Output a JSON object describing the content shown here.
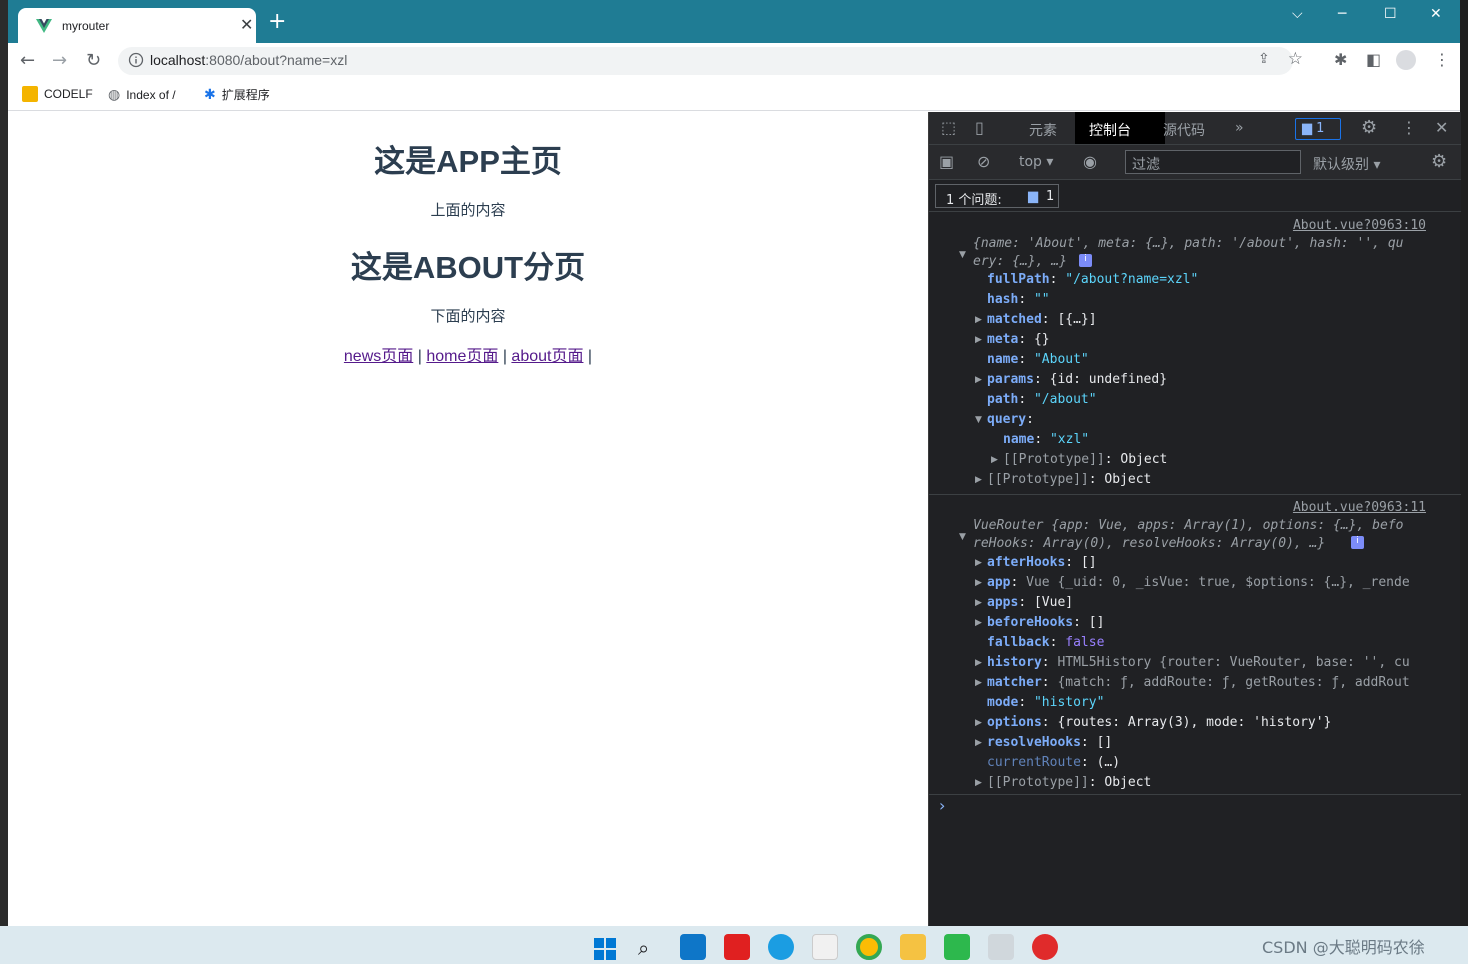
{
  "browser": {
    "tab_title": "myrouter",
    "new_tab": "+",
    "url_host": "localhost",
    "url_rest": ":8080/about?name=xzl",
    "bookmarks": [
      "CODELF",
      "Index of /",
      "扩展程序"
    ]
  },
  "page": {
    "heading_main": "这是APP主页",
    "text_top": "上面的内容",
    "heading_about": "这是ABOUT分页",
    "text_bottom": "下面的内容",
    "links": [
      "news页面",
      "home页面",
      "about页面"
    ],
    "separator": "|"
  },
  "devtools": {
    "tabs": [
      "元素",
      "控制台",
      "源代码"
    ],
    "more": "»",
    "issue_badge_count": "1",
    "context": "top",
    "filter_placeholder": "过滤",
    "levels": "默认级别",
    "issues_label": "1 个问题:",
    "issues_count": "1",
    "log1": {
      "source": "About.vue?0963:10",
      "summary_l1": "{name: 'About', meta: {…}, path: '/about', hash: '', qu",
      "summary_l2": "ery: {…}, …}",
      "props": [
        {
          "k": "fullPath",
          "v": "\"/about?name=xzl\""
        },
        {
          "k": "hash",
          "v": "\"\""
        },
        {
          "k": "matched",
          "v": "[{…}]"
        },
        {
          "k": "meta",
          "v": "{}"
        },
        {
          "k": "name",
          "v": "\"About\""
        },
        {
          "k": "params",
          "v": "{id: undefined}"
        },
        {
          "k": "path",
          "v": "\"/about\""
        },
        {
          "k": "query",
          "v": ""
        },
        {
          "k": "name",
          "v": "\"xzl\""
        },
        {
          "k": "[[Prototype]]",
          "v": "Object"
        },
        {
          "k": "[[Prototype]]",
          "v": "Object"
        }
      ]
    },
    "log2": {
      "source": "About.vue?0963:11",
      "summary_l1": "VueRouter {app: Vue, apps: Array(1), options: {…}, befo",
      "summary_l2": "reHooks: Array(0), resolveHooks: Array(0), …}",
      "props": [
        {
          "k": "afterHooks",
          "v": "[]"
        },
        {
          "k": "app",
          "v": "Vue {_uid: 0, _isVue: true, $options: {…}, _rende"
        },
        {
          "k": "apps",
          "v": "[Vue]"
        },
        {
          "k": "beforeHooks",
          "v": "[]"
        },
        {
          "k": "fallback",
          "v": "false"
        },
        {
          "k": "history",
          "v": "HTML5History {router: VueRouter, base: '', cu"
        },
        {
          "k": "matcher",
          "v": "{match: ƒ, addRoute: ƒ, getRoutes: ƒ, addRout"
        },
        {
          "k": "mode",
          "v": "\"history\""
        },
        {
          "k": "options",
          "v": "{routes: Array(3), mode: 'history'}"
        },
        {
          "k": "resolveHooks",
          "v": "[]"
        },
        {
          "k": "currentRoute",
          "v": "(…)"
        },
        {
          "k": "[[Prototype]]",
          "v": "Object"
        }
      ]
    },
    "prompt": "›"
  },
  "watermark": "CSDN @大聪明码农徐",
  "colors": {
    "titlebar": "#1f7c94",
    "heading": "#2c3e50",
    "link": "#551a8b",
    "devtools_bg": "#202124"
  }
}
